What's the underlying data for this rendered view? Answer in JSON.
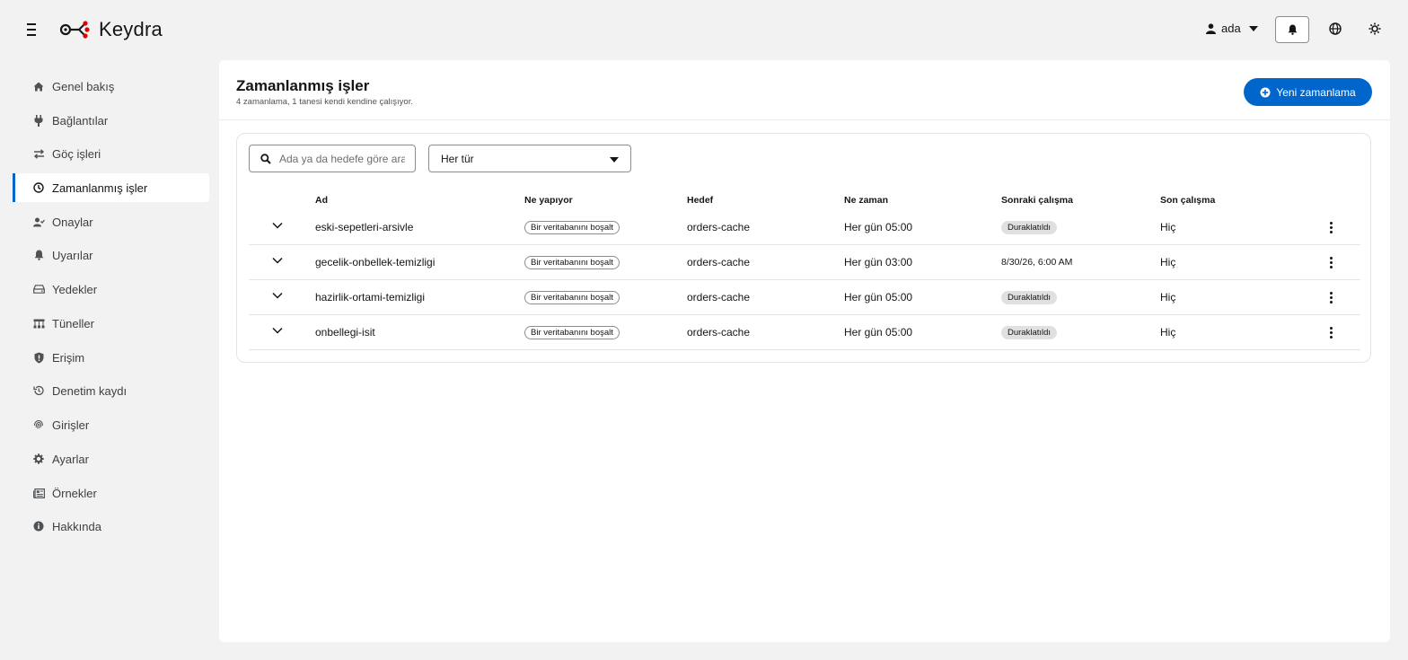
{
  "app": {
    "name": "Keydra"
  },
  "header": {
    "user": "ada"
  },
  "sidebar": {
    "items": [
      {
        "label": "Genel bakış",
        "icon": "home-icon"
      },
      {
        "label": "Bağlantılar",
        "icon": "plug-icon"
      },
      {
        "label": "Göç işleri",
        "icon": "arrows-exchange-icon"
      },
      {
        "label": "Zamanlanmış işler",
        "icon": "clock-icon",
        "active": true
      },
      {
        "label": "Onaylar",
        "icon": "user-check-icon"
      },
      {
        "label": "Uyarılar",
        "icon": "bell-icon"
      },
      {
        "label": "Yedekler",
        "icon": "hdd-icon"
      },
      {
        "label": "Tüneller",
        "icon": "network-icon"
      },
      {
        "label": "Erişim",
        "icon": "shield-icon"
      },
      {
        "label": "Denetim kaydı",
        "icon": "history-icon"
      },
      {
        "label": "Girişler",
        "icon": "fingerprint-icon"
      },
      {
        "label": "Ayarlar",
        "icon": "gear-icon"
      },
      {
        "label": "Örnekler",
        "icon": "newspaper-icon"
      },
      {
        "label": "Hakkında",
        "icon": "info-icon"
      }
    ]
  },
  "page": {
    "title": "Zamanlanmış işler",
    "subtitle": "4 zamanlama, 1 tanesi kendi kendine çalışıyor.",
    "new_button": "Yeni zamanlama"
  },
  "filters": {
    "search_placeholder": "Ada ya da hedefe göre ara",
    "type_selected": "Her tür"
  },
  "table": {
    "columns": [
      "Ad",
      "Ne yapıyor",
      "Hedef",
      "Ne zaman",
      "Sonraki çalışma",
      "Son çalışma"
    ],
    "rows": [
      {
        "name": "eski-sepetleri-arsivle",
        "action": "Bir veritabanını boşalt",
        "target": "orders-cache",
        "when": "Her gün 05:00",
        "next": "Duraklatıldı",
        "next_is_badge": true,
        "last": "Hiç"
      },
      {
        "name": "gecelik-onbellek-temizligi",
        "action": "Bir veritabanını boşalt",
        "target": "orders-cache",
        "when": "Her gün 03:00",
        "next": "8/30/26, 6:00 AM",
        "next_is_badge": false,
        "last": "Hiç"
      },
      {
        "name": "hazirlik-ortami-temizligi",
        "action": "Bir veritabanını boşalt",
        "target": "orders-cache",
        "when": "Her gün 05:00",
        "next": "Duraklatıldı",
        "next_is_badge": true,
        "last": "Hiç"
      },
      {
        "name": "onbellegi-isit",
        "action": "Bir veritabanını boşalt",
        "target": "orders-cache",
        "when": "Her gün 05:00",
        "next": "Duraklatıldı",
        "next_is_badge": true,
        "last": "Hiç"
      }
    ]
  },
  "colors": {
    "accent": "#0066cc",
    "background": "#f2f2f2",
    "brand_red": "#e00000"
  }
}
